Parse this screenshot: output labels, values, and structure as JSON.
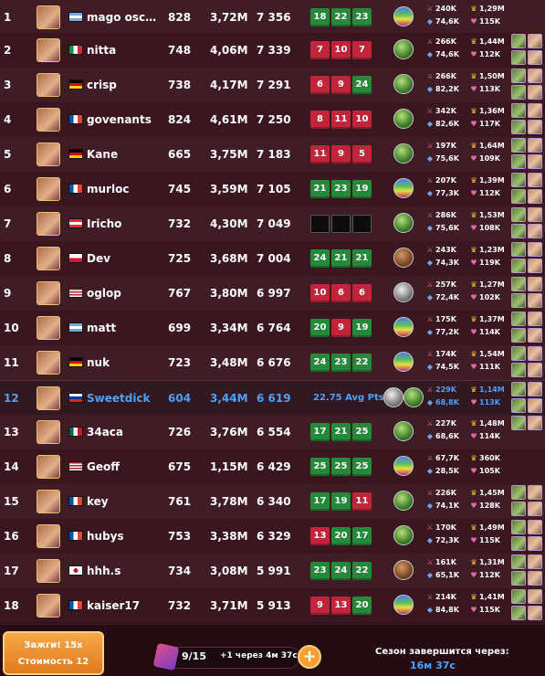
{
  "rows": [
    {
      "rank": "1",
      "name": "mago oscu...",
      "level": "828",
      "power": "3,72M",
      "points": "7 356",
      "scores": [
        "18",
        "22",
        "23"
      ],
      "colors": [
        "g",
        "g",
        "g"
      ],
      "orb": "rainbow",
      "atk": "240K",
      "def": "74,6K",
      "ego": "1,29M",
      "harm": "115K",
      "flag": "ar",
      "girls": 0
    },
    {
      "rank": "2",
      "name": "nitta",
      "level": "748",
      "power": "4,06M",
      "points": "7 339",
      "scores": [
        "7",
        "10",
        "7"
      ],
      "colors": [
        "r",
        "r",
        "r"
      ],
      "orb": "green",
      "atk": "266K",
      "def": "74,6K",
      "ego": "1,44M",
      "harm": "112K",
      "flag": "it",
      "girls": 6
    },
    {
      "rank": "3",
      "name": "crisp",
      "level": "738",
      "power": "4,17M",
      "points": "7 291",
      "scores": [
        "6",
        "9",
        "24"
      ],
      "colors": [
        "r",
        "r",
        "g"
      ],
      "orb": "green",
      "atk": "266K",
      "def": "82,2K",
      "ego": "1,50M",
      "harm": "113K",
      "flag": "de",
      "girls": 6
    },
    {
      "rank": "4",
      "name": "govenants",
      "level": "824",
      "power": "4,61M",
      "points": "7 250",
      "scores": [
        "8",
        "11",
        "10"
      ],
      "colors": [
        "r",
        "r",
        "r"
      ],
      "orb": "green",
      "atk": "342K",
      "def": "82,6K",
      "ego": "1,36M",
      "harm": "117K",
      "flag": "fr",
      "girls": 6
    },
    {
      "rank": "5",
      "name": "Kane",
      "level": "665",
      "power": "3,75M",
      "points": "7 183",
      "scores": [
        "11",
        "9",
        "5"
      ],
      "colors": [
        "r",
        "r",
        "r"
      ],
      "orb": "green",
      "atk": "197K",
      "def": "75,6K",
      "ego": "1,64M",
      "harm": "109K",
      "flag": "de",
      "girls": 6
    },
    {
      "rank": "6",
      "name": "murloc",
      "level": "745",
      "power": "3,59M",
      "points": "7 105",
      "scores": [
        "21",
        "23",
        "19"
      ],
      "colors": [
        "g",
        "g",
        "g"
      ],
      "orb": "rainbow",
      "atk": "207K",
      "def": "77,3K",
      "ego": "1,39M",
      "harm": "112K",
      "flag": "fr",
      "girls": 6
    },
    {
      "rank": "7",
      "name": "Iricho",
      "level": "732",
      "power": "4,30M",
      "points": "7 049",
      "scores": [
        "",
        "",
        ""
      ],
      "colors": [
        "b",
        "b",
        "b"
      ],
      "orb": "green",
      "atk": "286K",
      "def": "75,6K",
      "ego": "1,53M",
      "harm": "108K",
      "flag": "at",
      "girls": 6
    },
    {
      "rank": "8",
      "name": "Dev",
      "level": "725",
      "power": "3,68M",
      "points": "7 004",
      "scores": [
        "24",
        "21",
        "21"
      ],
      "colors": [
        "g",
        "g",
        "g"
      ],
      "orb": "brown",
      "atk": "243K",
      "def": "74,3K",
      "ego": "1,23M",
      "harm": "119K",
      "flag": "pl",
      "girls": 6
    },
    {
      "rank": "9",
      "name": "oglop",
      "level": "767",
      "power": "3,80M",
      "points": "6 997",
      "scores": [
        "10",
        "6",
        "6"
      ],
      "colors": [
        "r",
        "r",
        "r"
      ],
      "orb": "grey",
      "atk": "257K",
      "def": "72,4K",
      "ego": "1,27M",
      "harm": "102K",
      "flag": "us",
      "girls": 6
    },
    {
      "rank": "10",
      "name": "matt",
      "level": "699",
      "power": "3,34M",
      "points": "6 764",
      "scores": [
        "20",
        "9",
        "19"
      ],
      "colors": [
        "g",
        "r",
        "g"
      ],
      "orb": "rainbow",
      "atk": "175K",
      "def": "77,2K",
      "ego": "1,37M",
      "harm": "114K",
      "flag": "ar",
      "girls": 6
    },
    {
      "rank": "11",
      "name": "nuk",
      "level": "723",
      "power": "3,48M",
      "points": "6 676",
      "scores": [
        "24",
        "23",
        "22"
      ],
      "colors": [
        "g",
        "g",
        "g"
      ],
      "orb": "rainbow",
      "atk": "174K",
      "def": "74,5K",
      "ego": "1,54M",
      "harm": "111K",
      "flag": "de",
      "girls": 6
    },
    {
      "rank": "12",
      "name": "Sweetdick",
      "level": "604",
      "power": "3,44M",
      "points": "6 619",
      "avg": "22.75 Avg Pts",
      "me": true,
      "orb": "grey",
      "orb2": "green",
      "atk": "229K",
      "def": "68,8K",
      "ego": "1,14M",
      "harm": "113K",
      "flag": "ru",
      "girls": 6
    },
    {
      "rank": "13",
      "name": "34aca",
      "level": "726",
      "power": "3,76M",
      "points": "6 554",
      "scores": [
        "17",
        "21",
        "25"
      ],
      "colors": [
        "g",
        "g",
        "g"
      ],
      "orb": "green",
      "atk": "227K",
      "def": "68,6K",
      "ego": "1,48M",
      "harm": "114K",
      "flag": "mx",
      "girls": 2
    },
    {
      "rank": "14",
      "name": "Geoff",
      "level": "675",
      "power": "1,15M",
      "points": "6 429",
      "scores": [
        "25",
        "25",
        "25"
      ],
      "colors": [
        "g",
        "g",
        "g"
      ],
      "orb": "rainbow",
      "atk": "67,7K",
      "def": "28,5K",
      "ego": "360K",
      "harm": "105K",
      "flag": "us",
      "girls": 0
    },
    {
      "rank": "15",
      "name": "key",
      "level": "761",
      "power": "3,78M",
      "points": "6 340",
      "scores": [
        "17",
        "19",
        "11"
      ],
      "colors": [
        "g",
        "g",
        "r"
      ],
      "orb": "green",
      "atk": "226K",
      "def": "74,1K",
      "ego": "1,45M",
      "harm": "128K",
      "flag": "fr",
      "girls": 6
    },
    {
      "rank": "16",
      "name": "hubys",
      "level": "753",
      "power": "3,38M",
      "points": "6 329",
      "scores": [
        "13",
        "20",
        "17"
      ],
      "colors": [
        "r",
        "g",
        "g"
      ],
      "orb": "green",
      "atk": "170K",
      "def": "72,3K",
      "ego": "1,49M",
      "harm": "115K",
      "flag": "fr",
      "girls": 6
    },
    {
      "rank": "17",
      "name": "hhh.s",
      "level": "734",
      "power": "3,08M",
      "points": "5 991",
      "scores": [
        "23",
        "24",
        "22"
      ],
      "colors": [
        "g",
        "g",
        "g"
      ],
      "orb": "brown",
      "atk": "161K",
      "def": "65,1K",
      "ego": "1,31M",
      "harm": "112K",
      "flag": "jp",
      "girls": 6
    },
    {
      "rank": "18",
      "name": "kaiser17",
      "level": "732",
      "power": "3,71M",
      "points": "5 913",
      "scores": [
        "9",
        "13",
        "20"
      ],
      "colors": [
        "r",
        "r",
        "g"
      ],
      "orb": "rainbow",
      "atk": "214K",
      "def": "84,8K",
      "ego": "1,41M",
      "harm": "115K",
      "flag": "fr",
      "girls": 6
    }
  ],
  "bottom": {
    "ignite_line1": "Зажги! 15x",
    "ignite_line2": "Стоимость 12",
    "energy_value": "9/15",
    "energy_next": "+1 через 4м 37с",
    "season_label": "Сезон завершится через:",
    "season_time": "16м 37с"
  },
  "colors": {
    "accent": "#4aa2ff",
    "win": "#248a3a",
    "loss": "#c2253a",
    "bg": "#3a1a22"
  }
}
